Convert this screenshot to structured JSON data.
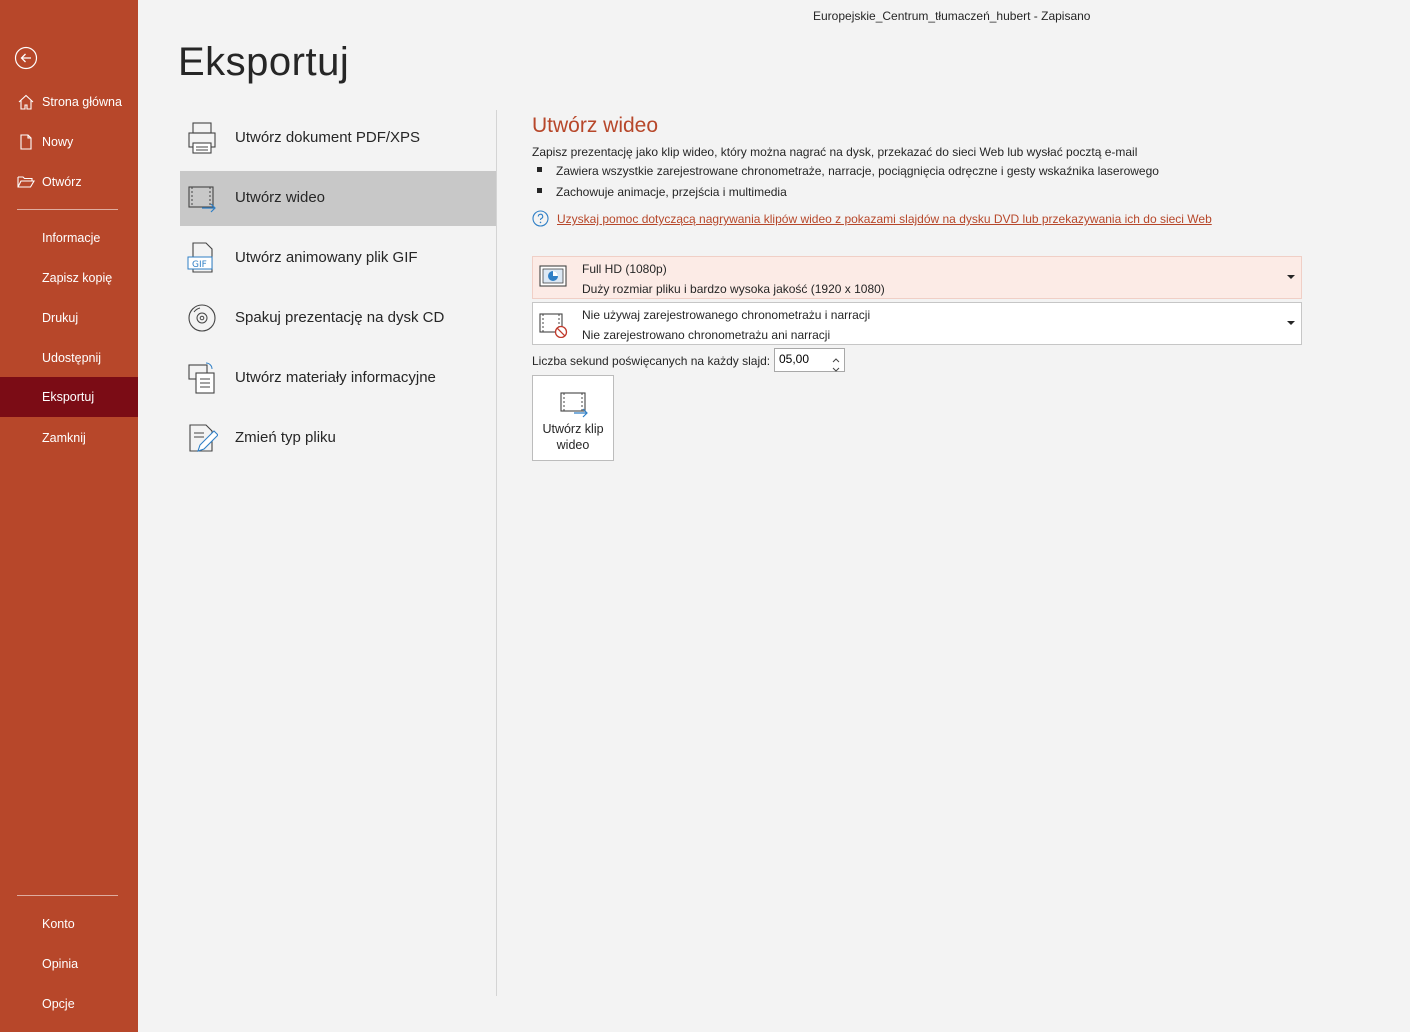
{
  "window": {
    "doc_title": "Europejskie_Centrum_tłumaczeń_hubert  -  Zapisano"
  },
  "sidebar": {
    "items": [
      {
        "label": "Strona główna",
        "icon": "home-icon"
      },
      {
        "label": "Nowy",
        "icon": "new-document-icon"
      },
      {
        "label": "Otwórz",
        "icon": "folder-open-icon"
      },
      {
        "label": "Informacje"
      },
      {
        "label": "Zapisz kopię"
      },
      {
        "label": "Drukuj"
      },
      {
        "label": "Udostępnij"
      },
      {
        "label": "Eksportuj",
        "active": true
      },
      {
        "label": "Zamknij"
      }
    ],
    "bottom_items": [
      {
        "label": "Konto"
      },
      {
        "label": "Opinia"
      },
      {
        "label": "Opcje"
      }
    ]
  },
  "page": {
    "title": "Eksportuj"
  },
  "export_options": [
    {
      "label": "Utwórz dokument PDF/XPS",
      "icon": "pdf-document-icon"
    },
    {
      "label": "Utwórz wideo",
      "icon": "video-icon",
      "selected": true
    },
    {
      "label": "Utwórz animowany plik GIF",
      "icon": "gif-icon"
    },
    {
      "label": "Spakuj prezentację na dysk CD",
      "icon": "cd-icon"
    },
    {
      "label": "Utwórz materiały informacyjne",
      "icon": "handouts-icon"
    },
    {
      "label": "Zmień typ pliku",
      "icon": "change-file-type-icon"
    }
  ],
  "panel": {
    "title": "Utwórz wideo",
    "description": "Zapisz prezentację jako klip wideo, który można nagrać na dysk, przekazać do sieci Web lub wysłać pocztą e-mail",
    "bullets": [
      "Zawiera wszystkie zarejestrowane chronometraże, narracje, pociągnięcia odręczne i gesty wskaźnika laserowego",
      "Zachowuje animacje, przejścia i multimedia"
    ],
    "help_link": "Uzyskaj pomoc dotyczącą nagrywania klipów wideo z pokazami slajdów na dysku DVD lub przekazywania ich do sieci Web",
    "quality_dropdown": {
      "line1": "Full HD (1080p)",
      "line2": "Duży rozmiar pliku i bardzo wysoka jakość (1920 x 1080)"
    },
    "timing_dropdown": {
      "line1": "Nie używaj zarejestrowanego chronometrażu i narracji",
      "line2": "Nie zarejestrowano chronometrażu ani narracji"
    },
    "seconds_label": "Liczba sekund poświęcanych na każdy slajd:",
    "seconds_value": "05,00",
    "create_button": "Utwórz klip wideo"
  },
  "colors": {
    "accent": "#b7472a",
    "sidebar_active": "#7b0c15",
    "selected_option": "#c8c8c8"
  }
}
